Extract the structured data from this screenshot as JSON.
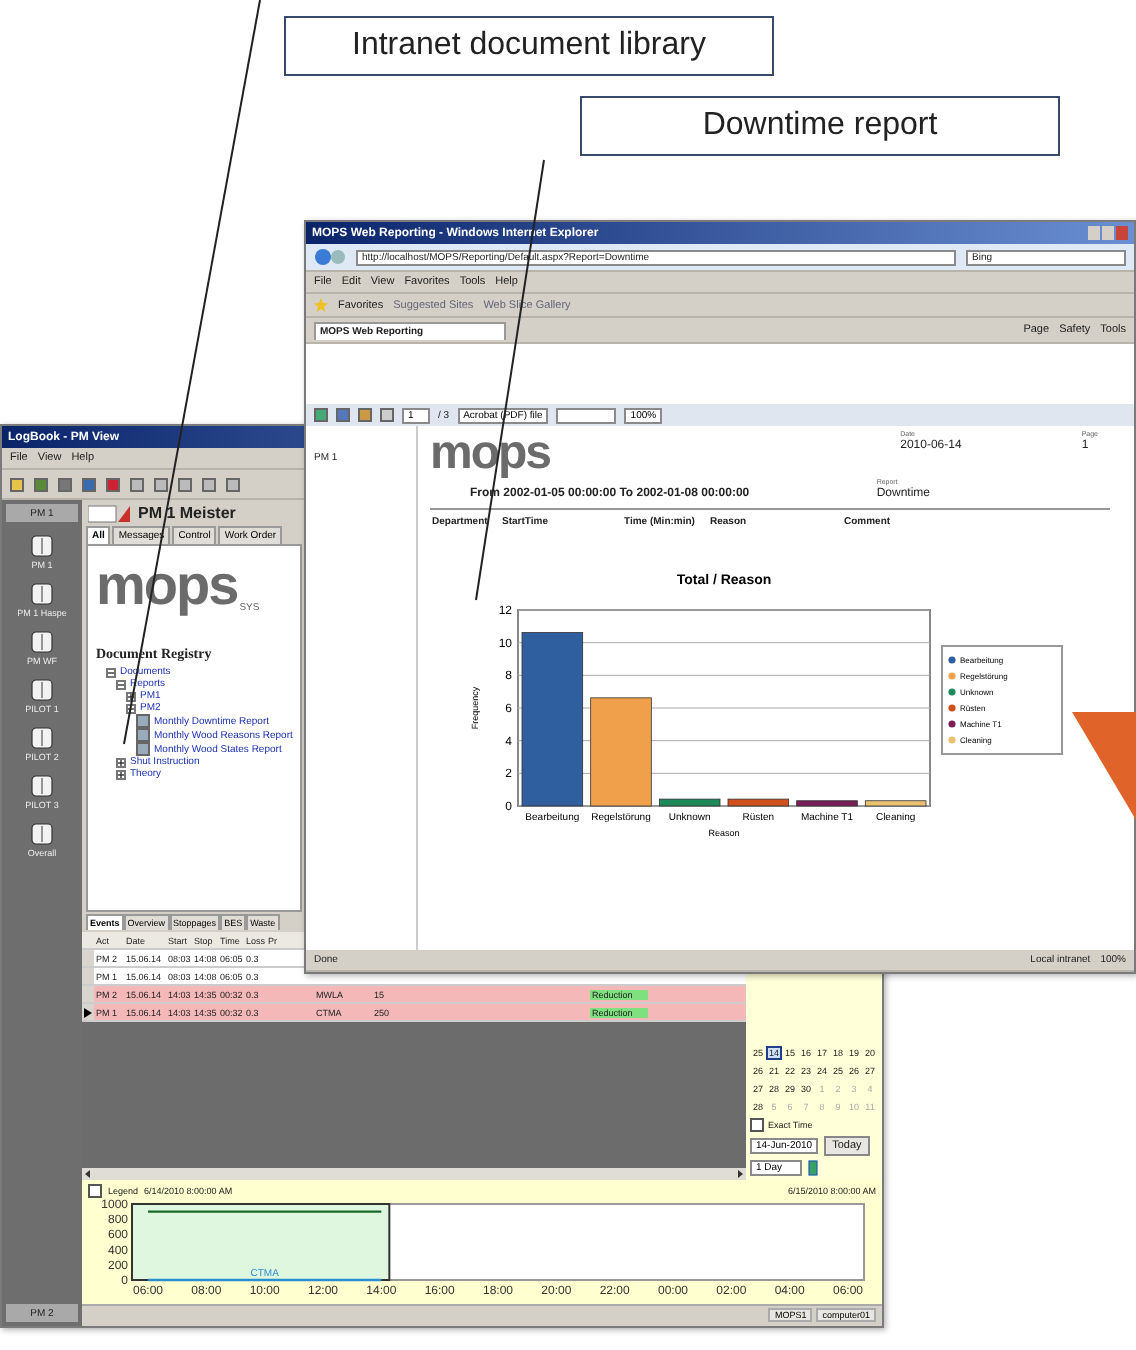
{
  "callouts": [
    {
      "text": "Intranet document library"
    },
    {
      "text": "Downtime report"
    }
  ],
  "logbook": {
    "title": "LogBook - PM View",
    "menu": [
      "File",
      "View",
      "Help"
    ],
    "station": "PM 1",
    "header": "PM 1 Meister",
    "tabs": [
      {
        "label": "All",
        "selected": true
      },
      {
        "label": "Messages",
        "selected": false
      },
      {
        "label": "Control",
        "selected": false
      },
      {
        "label": "Work Order",
        "selected": false
      }
    ],
    "logo": "mops",
    "logo_suffix": "SYS",
    "registry_title": "Document Registry",
    "tree": [
      {
        "label": "Documents",
        "expanded": true,
        "children": [
          {
            "label": "Reports",
            "expanded": true,
            "children": [
              {
                "label": "PM1",
                "expanded": false
              },
              {
                "label": "PM2",
                "expanded": true,
                "children": [
                  {
                    "label": "Monthly Downtime Report"
                  },
                  {
                    "label": "Monthly Wood Reasons Report"
                  },
                  {
                    "label": "Monthly Wood States Report"
                  }
                ]
              }
            ]
          },
          {
            "label": "Shut Instruction",
            "expanded": false
          },
          {
            "label": "Theory",
            "expanded": false
          }
        ]
      }
    ],
    "sidebar": [
      {
        "label": "PM 1"
      },
      {
        "label": "PM 1 Haspe"
      },
      {
        "label": "PM WF"
      },
      {
        "label": "PILOT 1"
      },
      {
        "label": "PILOT 2"
      },
      {
        "label": "PILOT 3"
      },
      {
        "label": "Overall"
      }
    ],
    "footer_station": "PM 2",
    "event_tabs": [
      {
        "label": "Events",
        "selected": true
      },
      {
        "label": "Overview",
        "selected": false
      },
      {
        "label": "Stoppages",
        "selected": false
      },
      {
        "label": "BES",
        "selected": false
      },
      {
        "label": "Waste",
        "selected": false
      }
    ],
    "table": {
      "columns": [
        "Act",
        "Date",
        "Start",
        "Stop",
        "Time",
        "Loss",
        "Pr"
      ],
      "rows": [
        {
          "cells": [
            "PM 2",
            "15.06.14",
            "08:03",
            "14:08",
            "06:05",
            "0.3"
          ],
          "extra": [],
          "alarm": false,
          "selected": false
        },
        {
          "cells": [
            "PM 1",
            "15.06.14",
            "08:03",
            "14:08",
            "06:05",
            "0.3"
          ],
          "extra": [],
          "alarm": false,
          "selected": false
        },
        {
          "cells": [
            "PM 2",
            "15.06.14",
            "14:03",
            "14:35",
            "00:32",
            "0.3"
          ],
          "extra": [
            "MWLA",
            "15",
            "Reduction"
          ],
          "alarm": true,
          "selected": false
        },
        {
          "cells": [
            "PM 1",
            "15.06.14",
            "14:03",
            "14:35",
            "00:32",
            "0.3"
          ],
          "extra": [
            "CTMA",
            "250",
            "Reduction"
          ],
          "alarm": true,
          "selected": true
        }
      ]
    },
    "calendar": [
      {
        "week": "25",
        "days": [
          {
            "day": "14",
            "selected": true,
            "muted": false
          },
          {
            "day": "15",
            "selected": false,
            "muted": false
          },
          {
            "day": "16",
            "selected": false,
            "muted": false
          },
          {
            "day": "17",
            "selected": false,
            "muted": false
          },
          {
            "day": "18",
            "selected": false,
            "muted": false
          },
          {
            "day": "19",
            "selected": false,
            "muted": false
          },
          {
            "day": "20",
            "selected": false,
            "muted": false
          }
        ]
      },
      {
        "week": "26",
        "days": [
          {
            "day": "21",
            "selected": false,
            "muted": false
          },
          {
            "day": "22",
            "selected": false,
            "muted": false
          },
          {
            "day": "23",
            "selected": false,
            "muted": false
          },
          {
            "day": "24",
            "selected": false,
            "muted": false
          },
          {
            "day": "25",
            "selected": false,
            "muted": false
          },
          {
            "day": "26",
            "selected": false,
            "muted": false
          },
          {
            "day": "27",
            "selected": false,
            "muted": false
          }
        ]
      },
      {
        "week": "27",
        "days": [
          {
            "day": "28",
            "selected": false,
            "muted": false
          },
          {
            "day": "29",
            "selected": false,
            "muted": false
          },
          {
            "day": "30",
            "selected": false,
            "muted": false
          },
          {
            "day": "1",
            "selected": false,
            "muted": true
          },
          {
            "day": "2",
            "selected": false,
            "muted": true
          },
          {
            "day": "3",
            "selected": false,
            "muted": true
          },
          {
            "day": "4",
            "selected": false,
            "muted": true
          }
        ]
      },
      {
        "week": "28",
        "days": [
          {
            "day": "5",
            "selected": false,
            "muted": true
          },
          {
            "day": "6",
            "selected": false,
            "muted": true
          },
          {
            "day": "7",
            "selected": false,
            "muted": true
          },
          {
            "day": "8",
            "selected": false,
            "muted": true
          },
          {
            "day": "9",
            "selected": false,
            "muted": true
          },
          {
            "day": "10",
            "selected": false,
            "muted": true
          },
          {
            "day": "11",
            "selected": false,
            "muted": true
          }
        ]
      }
    ],
    "exact_time": {
      "label": "Exact Time",
      "checked": false
    },
    "date_field": "14-Jun-2010",
    "today_button": "Today",
    "interval_field": "1 Day",
    "trend": {
      "legend": {
        "label": "Legend",
        "checked": false
      },
      "start": "6/14/2010 8:00:00 AM",
      "end": "6/15/2010 8:00:00 AM",
      "chart_data": {
        "type": "line",
        "x": [
          "06:00",
          "08:00",
          "10:00",
          "12:00",
          "14:00",
          "16:00",
          "18:00",
          "20:00",
          "22:00",
          "00:00",
          "02:00",
          "04:00",
          "06:00"
        ],
        "series": [
          {
            "color": "#1a6b2a",
            "values": [
              900,
              900,
              900,
              900,
              900,
              null,
              null,
              null,
              null,
              null,
              null,
              null,
              null
            ]
          },
          {
            "name": "CTMA",
            "color": "#2a8fd0",
            "values": [
              0,
              0,
              0,
              0,
              0,
              null,
              null,
              null,
              null,
              null,
              null,
              null,
              null
            ]
          }
        ],
        "ylim": [
          0,
          1000
        ],
        "yticks": [
          0,
          200,
          400,
          600,
          800,
          1000
        ]
      }
    },
    "status_bar": [
      "MOPS1",
      "computer01"
    ]
  },
  "browser": {
    "title": "MOPS Web Reporting - Windows Internet Explorer",
    "address": "http://localhost/MOPS/Reporting/Default.aspx?Report=Downtime",
    "search": "Bing",
    "menu": [
      "File",
      "Edit",
      "View",
      "Favorites",
      "Tools",
      "Help"
    ],
    "favorites": [
      "Favorites",
      "Suggested Sites",
      "Web Slice Gallery"
    ],
    "tab": "MOPS Web Reporting",
    "commands": [
      "Page",
      "Safety",
      "Tools"
    ],
    "report_toolbar": {
      "page": "1",
      "page_count": "/ 3",
      "export": "Acrobat (PDF) file",
      "zoom": "100%"
    },
    "nav_item": "PM 1",
    "report": {
      "logo": "mops",
      "date_label": "Date",
      "date": "2010-06-14",
      "page_label": "Page",
      "page": "1",
      "range": "From 2002-01-05 00:00:00 To 2002-01-08 00:00:00",
      "report_label": "Report",
      "report_name": "Downtime",
      "columns": [
        "Department",
        "StartTime",
        "Time (Min:min)",
        "Reason",
        "Comment"
      ],
      "chart_data": {
        "type": "bar",
        "title": "Total / Reason",
        "xlabel": "Reason",
        "ylabel": "Frequency",
        "categories": [
          "Bearbeitung",
          "Regelstörung",
          "Unknown",
          "Rüsten",
          "Machine T1",
          "Cleaning"
        ],
        "stacked": true,
        "series": [
          {
            "name": "Bearbeitung",
            "color": "#2f5f9e",
            "values": [
              10.5,
              null,
              null,
              null,
              null,
              null
            ]
          },
          {
            "name": "Regelstörung",
            "color": "#f0a04b",
            "values": [
              null,
              6.5,
              null,
              null,
              null,
              null
            ]
          },
          {
            "name": "Unknown",
            "color": "#1e8a5a",
            "values": [
              null,
              null,
              0.3,
              null,
              null,
              null
            ]
          },
          {
            "name": "Rüsten",
            "color": "#d0501e",
            "values": [
              null,
              null,
              null,
              0.3,
              null,
              null
            ]
          },
          {
            "name": "Machine T1",
            "color": "#7a1f5a",
            "values": [
              null,
              null,
              null,
              null,
              0.2,
              null
            ]
          },
          {
            "name": "Cleaning",
            "color": "#e8c070",
            "values": [
              null,
              null,
              null,
              null,
              null,
              0.2
            ]
          }
        ],
        "ylim": [
          0,
          12
        ],
        "yticks": [
          0,
          2,
          4,
          6,
          8,
          10,
          12
        ],
        "grid": true,
        "legend": "right"
      }
    },
    "status": {
      "left": "Done",
      "zone": "Local intranet",
      "zoom": "100%"
    }
  }
}
